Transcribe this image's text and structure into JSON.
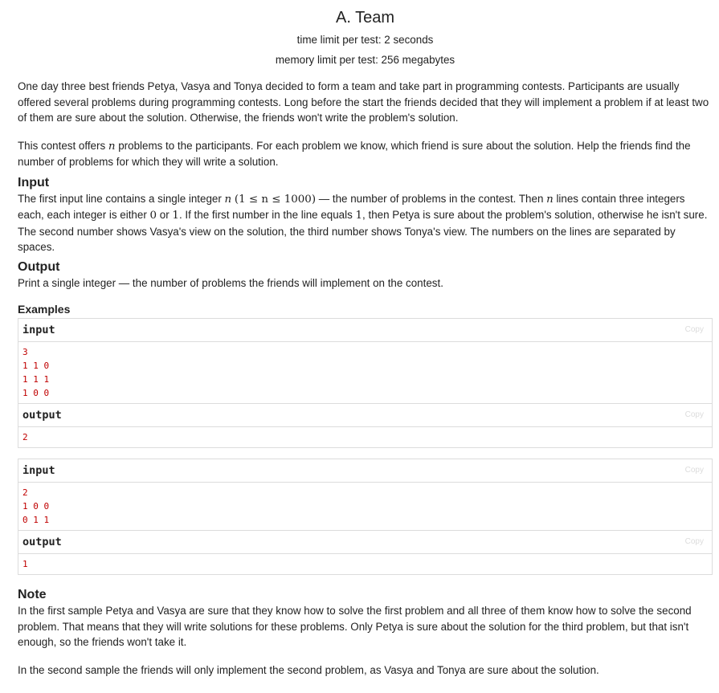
{
  "header": {
    "title": "A. Team",
    "time_limit": "time limit per test: 2 seconds",
    "memory_limit": "memory limit per test: 256 megabytes"
  },
  "legend": {
    "p1": "One day three best friends Petya, Vasya and Tonya decided to form a team and take part in programming contests. Participants are usually offered several problems during programming contests. Long before the start the friends decided that they will implement a problem if at least two of them are sure about the solution. Otherwise, the friends won't write the problem's solution.",
    "p2_a": "This contest offers ",
    "p2_var": "n",
    "p2_b": " problems to the participants. For each problem we know, which friend is sure about the solution. Help the friends find the number of problems for which they will write a solution."
  },
  "input_spec": {
    "title": "Input",
    "t1": "The first input line contains a single integer ",
    "n1": "n",
    "formula": "(1 ≤ n ≤ 1000)",
    "t2": " — the number of problems in the contest. Then ",
    "n2": "n",
    "t3": " lines contain three integers each, each integer is either ",
    "zero": "0",
    "t4": " or ",
    "one": "1",
    "t5": ". If the first number in the line equals ",
    "one2": "1",
    "t6": ", then Petya is sure about the problem's solution, otherwise he isn't sure. The second number shows Vasya's view on the solution, the third number shows Tonya's view. The numbers on the lines are separated by spaces."
  },
  "output_spec": {
    "title": "Output",
    "text": "Print a single integer — the number of problems the friends will implement on the contest."
  },
  "examples": {
    "title": "Examples",
    "input_label": "input",
    "output_label": "output",
    "copy_label": "Copy",
    "ex1": {
      "input": [
        "3",
        "1 1 0",
        "1 1 1",
        "1 0 0"
      ],
      "output": [
        "2"
      ]
    },
    "ex2": {
      "input": [
        "2",
        "1 0 0",
        "0 1 1"
      ],
      "output": [
        "1"
      ]
    }
  },
  "note": {
    "title": "Note",
    "p1": "In the first sample Petya and Vasya are sure that they know how to solve the first problem and all three of them know how to solve the second problem. That means that they will write solutions for these problems. Only Petya is sure about the solution for the third problem, but that isn't enough, so the friends won't take it.",
    "p2": "In the second sample the friends will only implement the second problem, as Vasya and Tonya are sure about the solution."
  }
}
